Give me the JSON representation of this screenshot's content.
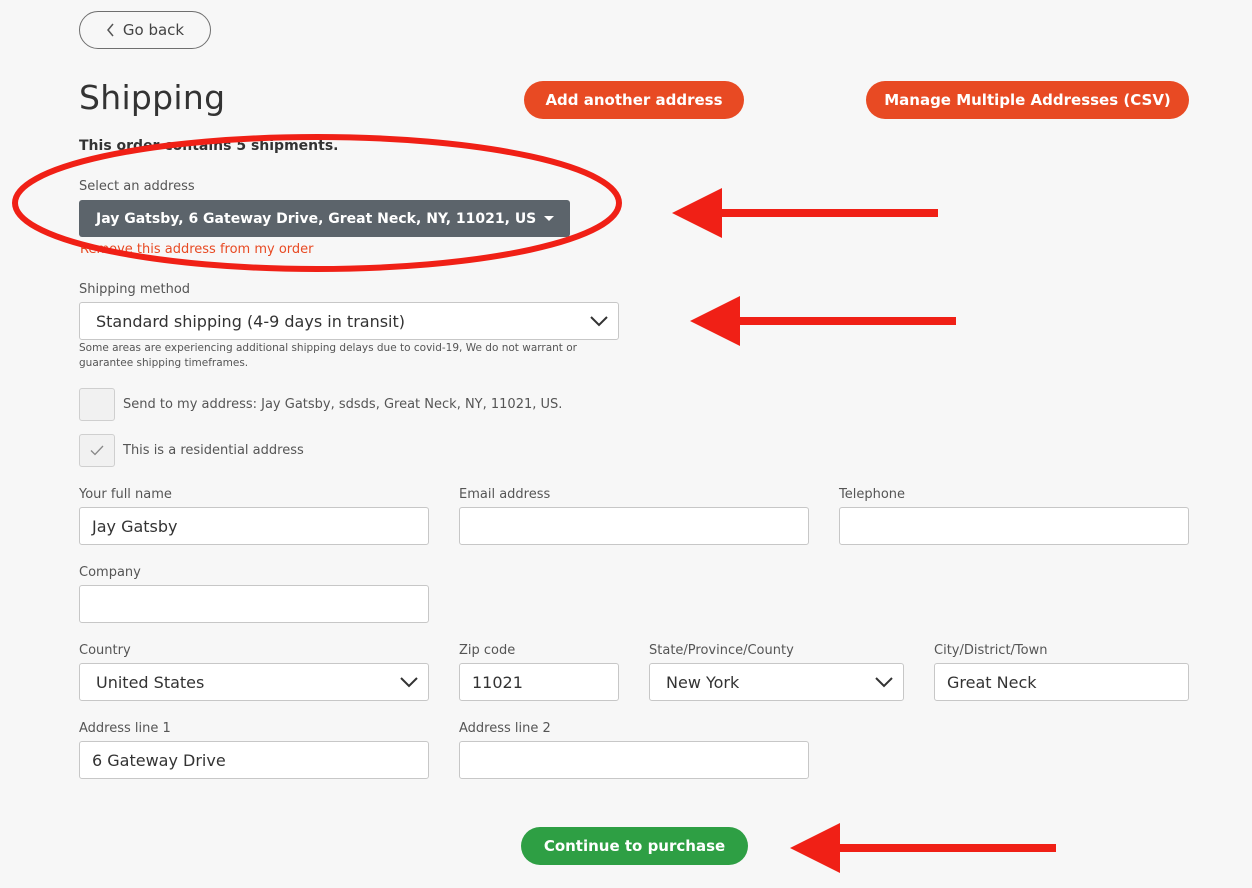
{
  "nav": {
    "back_label": "Go back"
  },
  "header": {
    "title": "Shipping",
    "add_address_label": "Add another address",
    "manage_csv_label": "Manage Multiple Addresses (CSV)"
  },
  "order": {
    "summary": "This order contains 5 shipments."
  },
  "address_picker": {
    "label": "Select an address",
    "selected": "Jay Gatsby, 6 Gateway Drive, Great Neck, NY, 11021, US",
    "remove_label": "Remove this address from my order"
  },
  "shipping_method": {
    "label": "Shipping method",
    "selected": "Standard shipping (4-9 days in transit)",
    "note": "Some areas are experiencing additional shipping delays due to covid-19, We do not warrant or guarantee shipping timeframes."
  },
  "checkboxes": [
    {
      "label": "Send to my address: Jay Gatsby, sdsds, Great Neck, NY, 11021, US.",
      "checked": false
    },
    {
      "label": "This is a residential address",
      "checked": true
    }
  ],
  "form": {
    "full_name": {
      "label": "Your full name",
      "value": "Jay Gatsby"
    },
    "email": {
      "label": "Email address",
      "value": ""
    },
    "telephone": {
      "label": "Telephone",
      "value": ""
    },
    "company": {
      "label": "Company",
      "value": ""
    },
    "country": {
      "label": "Country",
      "value": "United States"
    },
    "zip": {
      "label": "Zip code",
      "value": "11021"
    },
    "state": {
      "label": "State/Province/County",
      "value": "New York"
    },
    "city": {
      "label": "City/District/Town",
      "value": "Great Neck"
    },
    "address1": {
      "label": "Address line 1",
      "value": "6 Gateway Drive"
    },
    "address2": {
      "label": "Address line 2",
      "value": ""
    }
  },
  "actions": {
    "continue_label": "Continue to purchase"
  },
  "colors": {
    "accent": "#e84a23",
    "success": "#2e9f44",
    "select_dark": "#5c646b",
    "annotation": "#f02016"
  },
  "icons": {
    "back": "chevron-left-icon",
    "dropdown": "chevron-down-icon",
    "caret": "caret-down-icon",
    "check": "checkmark-icon"
  }
}
